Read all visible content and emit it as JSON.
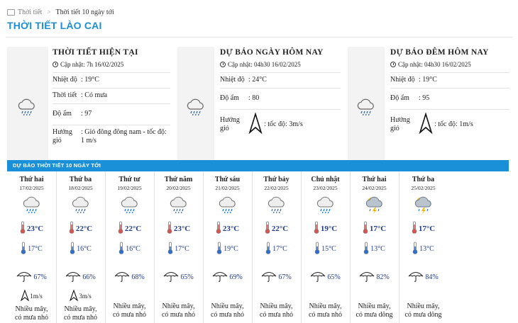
{
  "breadcrumb": {
    "home": "Thời tiết",
    "current": "Thời tiết 10 ngày tới"
  },
  "page": {
    "title": "THỜI TIẾT LÀO CAI"
  },
  "current": {
    "title": "THỜI TIẾT HIỆN TẠI",
    "updated": "Cập nhật: 7h 16/02/2025",
    "rows": [
      {
        "k": "Nhiệt độ",
        "v": ": 19°C"
      },
      {
        "k": "Thời tiết",
        "v": ": Có mưa"
      },
      {
        "k": "Độ ẩm",
        "v": ": 97"
      },
      {
        "k": "Hướng gió",
        "v": ": Gió đông đông nam - tốc độ: 1 m/s"
      }
    ]
  },
  "today": {
    "title": "DỰ BÁO NGÀY HÔM NAY",
    "updated": "Cập nhật: 04h30 16/02/2025",
    "rows": [
      {
        "k": "Nhiệt độ",
        "v": ": 24°C"
      },
      {
        "k": "Độ ẩm",
        "v": ": 80"
      },
      {
        "k": "Hướng gió",
        "v": ": tốc độ: 3m/s"
      }
    ]
  },
  "tonight": {
    "title": "DỰ BÁO ĐÊM HÔM NAY",
    "updated": "Cập nhật: 04h30 16/02/2025",
    "rows": [
      {
        "k": "Nhiệt độ",
        "v": ": 19°C"
      },
      {
        "k": "Độ ẩm",
        "v": ": 95"
      },
      {
        "k": "Hướng gió",
        "v": ": tốc độ: 1m/s"
      }
    ]
  },
  "forecast": {
    "header": "DỰ BÁO THỜI TIẾT 10 NGÀY TỚI",
    "days": [
      {
        "name": "Thứ hai",
        "date": "17/02/2025",
        "icon": "cloud-rain-icon",
        "max": "23°C",
        "min": "17°C",
        "hum": "67%",
        "wind": "1m/s",
        "cond1": "Nhiều mây,",
        "cond2": "có mưa nhỏ"
      },
      {
        "name": "Thứ ba",
        "date": "18/02/2025",
        "icon": "cloud-rain-icon",
        "max": "22°C",
        "min": "16°C",
        "hum": "66%",
        "wind": "3m/s",
        "cond1": "Nhiều mây,",
        "cond2": "có mưa nhỏ"
      },
      {
        "name": "Thứ tư",
        "date": "19/02/2025",
        "icon": "cloud-rain-icon",
        "max": "22°C",
        "min": "16°C",
        "hum": "68%",
        "wind": "",
        "cond1": "Nhiều mây,",
        "cond2": "có mưa nhỏ"
      },
      {
        "name": "Thứ năm",
        "date": "20/02/2025",
        "icon": "cloud-rain-icon",
        "max": "23°C",
        "min": "17°C",
        "hum": "65%",
        "wind": "",
        "cond1": "Nhiều mây,",
        "cond2": "có mưa nhỏ"
      },
      {
        "name": "Thứ sáu",
        "date": "21/02/2025",
        "icon": "cloud-rain-icon",
        "max": "23°C",
        "min": "19°C",
        "hum": "69%",
        "wind": "",
        "cond1": "Nhiều mây,",
        "cond2": "có mưa nhỏ"
      },
      {
        "name": "Thứ bảy",
        "date": "22/02/2025",
        "icon": "cloud-rain-icon",
        "max": "22°C",
        "min": "17°C",
        "hum": "67%",
        "wind": "",
        "cond1": "Nhiều mây,",
        "cond2": "có mưa nhỏ"
      },
      {
        "name": "Chủ nhật",
        "date": "23/02/2025",
        "icon": "cloud-rain-icon",
        "max": "19°C",
        "min": "15°C",
        "hum": "65%",
        "wind": "",
        "cond1": "Nhiều mây,",
        "cond2": "có mưa nhỏ"
      },
      {
        "name": "Thứ hai",
        "date": "24/02/2025",
        "icon": "cloud-storm-icon",
        "max": "17°C",
        "min": "13°C",
        "hum": "82%",
        "wind": "",
        "cond1": "Nhiều mây,",
        "cond2": "có mưa dông"
      },
      {
        "name": "Thứ ba",
        "date": "25/02/2025",
        "icon": "cloud-storm-icon",
        "max": "17°C",
        "min": "13°C",
        "hum": "84%",
        "wind": "",
        "cond1": "Nhiều mây,",
        "cond2": "có mưa dông"
      }
    ]
  },
  "colors": {
    "accent": "#1a8fd6",
    "header_bar": "#1a90d9",
    "temp_text": "#1f3b8a",
    "thermo_hot": "#d9534f",
    "thermo_cold": "#2a6fd1"
  }
}
